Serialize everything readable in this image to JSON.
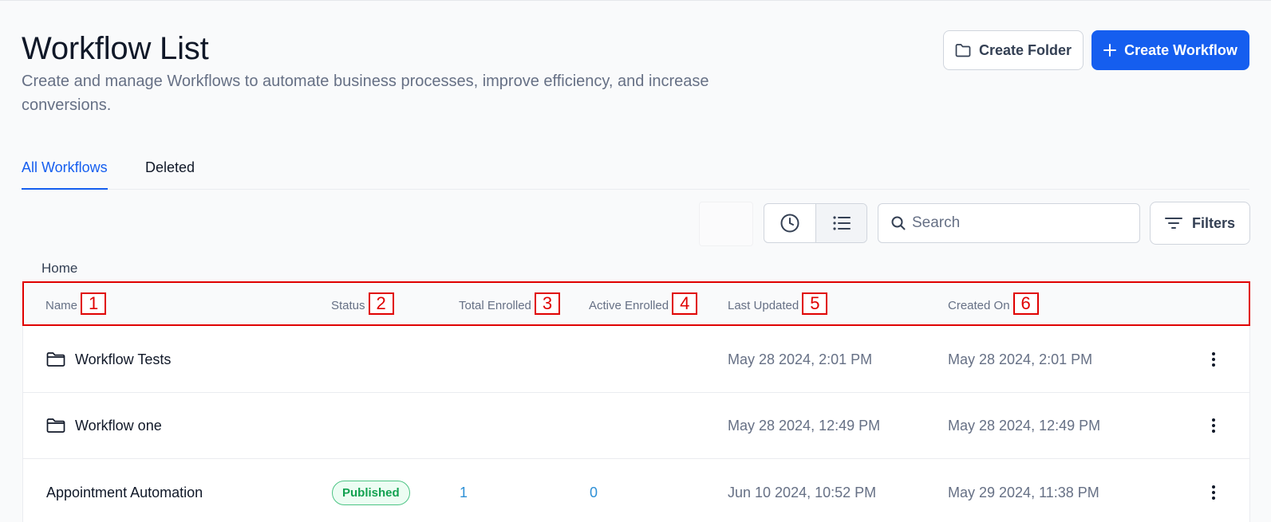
{
  "page": {
    "title": "Workflow List",
    "subtitle": "Create and manage Workflows to automate business processes, improve efficiency, and increase conversions."
  },
  "buttons": {
    "create_folder": "Create Folder",
    "create_workflow": "Create Workflow",
    "filters": "Filters"
  },
  "tabs": [
    {
      "label": "All Workflows",
      "active": true
    },
    {
      "label": "Deleted",
      "active": false
    }
  ],
  "search": {
    "placeholder": "Search",
    "value": ""
  },
  "breadcrumb": "Home",
  "table": {
    "columns": [
      {
        "label": "Name",
        "tag": "1"
      },
      {
        "label": "Status",
        "tag": "2"
      },
      {
        "label": "Total Enrolled",
        "tag": "3"
      },
      {
        "label": "Active Enrolled",
        "tag": "4"
      },
      {
        "label": "Last Updated",
        "tag": "5"
      },
      {
        "label": "Created On",
        "tag": "6"
      }
    ],
    "rows": [
      {
        "type": "folder",
        "name": "Workflow Tests",
        "status": "",
        "total_enrolled": "",
        "active_enrolled": "",
        "last_updated": "May 28 2024, 2:01 PM",
        "created_on": "May 28 2024, 2:01 PM"
      },
      {
        "type": "folder",
        "name": "Workflow one",
        "status": "",
        "total_enrolled": "",
        "active_enrolled": "",
        "last_updated": "May 28 2024, 12:49 PM",
        "created_on": "May 28 2024, 12:49 PM"
      },
      {
        "type": "workflow",
        "name": "Appointment Automation",
        "status": "Published",
        "total_enrolled": "1",
        "active_enrolled": "0",
        "last_updated": "Jun 10 2024, 10:52 PM",
        "created_on": "May 29 2024, 11:38 PM"
      }
    ]
  },
  "colors": {
    "primary": "#155eef",
    "annotation": "#e00000",
    "published": "#12a150"
  }
}
